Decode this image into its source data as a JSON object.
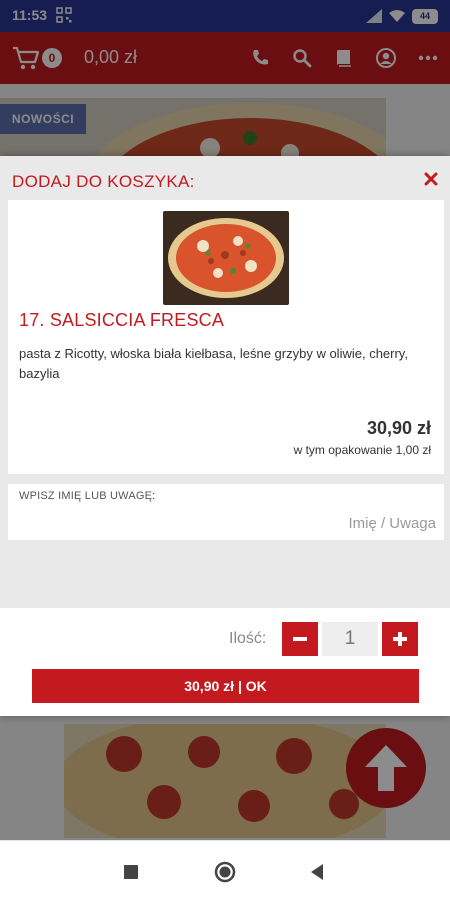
{
  "status_bar": {
    "time": "11:53",
    "battery": "44"
  },
  "header": {
    "cart_count": "0",
    "cart_total": "0,00 zł"
  },
  "background": {
    "badge_label": "NOWOŚCI"
  },
  "modal": {
    "title": "DODAJ DO KOSZYKA:",
    "product": {
      "name": "17. SALSICCIA FRESCA",
      "description": " pasta z Ricotty, włoska biała kiełbasa, leśne grzyby w oliwie, cherry, bazylia",
      "price": "30,90 zł",
      "packaging_note": "w tym opakowanie 1,00 zł"
    },
    "note": {
      "label": "WPISZ IMIĘ LUB UWAGĘ:",
      "placeholder": "Imię / Uwaga",
      "value": ""
    },
    "quantity": {
      "label": "Ilość:",
      "value": "1"
    },
    "ok_label": "30,90 zł | OK"
  },
  "colors": {
    "accent": "#c41a1f",
    "status_bar": "#283593",
    "badge": "#5b6fb0"
  },
  "icons": [
    "cart-icon",
    "phone-icon",
    "search-icon",
    "menu-book-icon",
    "account-icon",
    "more-icon",
    "close-icon",
    "minus-icon",
    "plus-icon",
    "arrow-up-icon",
    "nav-square-icon",
    "nav-circle-icon",
    "nav-back-icon"
  ]
}
